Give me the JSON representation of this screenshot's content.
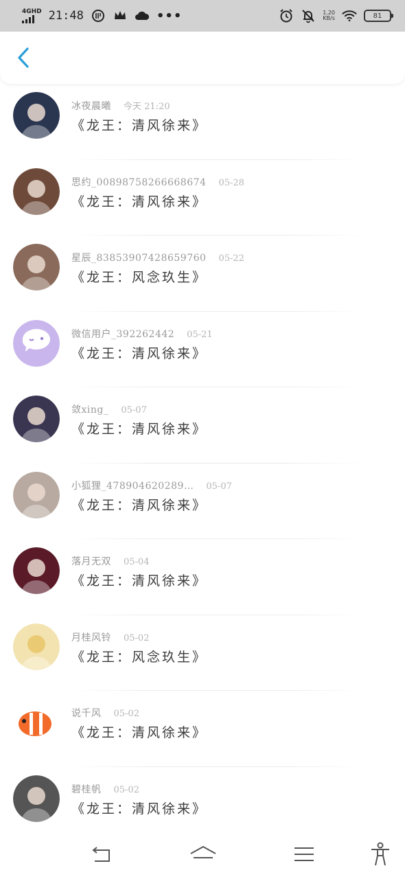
{
  "status_bar": {
    "network": "4GHD",
    "time": "21:48",
    "speed_value": "1.20",
    "speed_unit": "KB/s",
    "battery": "81"
  },
  "header": {
    "back_icon": "chevron-left-icon",
    "accent_color": "#2a9fd8"
  },
  "items": [
    {
      "user": "冰夜晨曦",
      "date": "今天 21:20",
      "title": "《龙王：清风徐来》",
      "avatar_color": "#2a3550"
    },
    {
      "user": "思约_008987582666686​74",
      "date": "05-28",
      "title": "《龙王：清风徐来》",
      "avatar_color": "#6e4a3a"
    },
    {
      "user": "星辰_83853907428659760",
      "date": "05-22",
      "title": "《龙王：风念玖生》",
      "avatar_color": "#8a6a5a"
    },
    {
      "user": "微信用户_392262442",
      "date": "05-21",
      "title": "《龙王：清风徐来》",
      "avatar_color": "#c9b6ec"
    },
    {
      "user": "敛xing_",
      "date": "05-07",
      "title": "《龙王：清风徐来》",
      "avatar_color": "#3a3550"
    },
    {
      "user": "小狐狸_478904620289…",
      "date": "05-07",
      "title": "《龙王：清风徐来》",
      "avatar_color": "#b8aaa0"
    },
    {
      "user": "落月无双",
      "date": "05-04",
      "title": "《龙王：清风徐来》",
      "avatar_color": "#5a1a28"
    },
    {
      "user": "月桂风铃",
      "date": "05-02",
      "title": "《龙王：风念玖生》",
      "avatar_color": "#f3e3b0"
    },
    {
      "user": "说千风",
      "date": "05-02",
      "title": "《龙王：清风徐来》",
      "avatar_color": "#ffffff"
    },
    {
      "user": "碧桂帆",
      "date": "05-02",
      "title": "《龙王：清风徐来》",
      "avatar_color": "#555555"
    }
  ],
  "nav": {
    "back": "back-icon",
    "home": "home-icon",
    "menu": "menu-icon",
    "accessibility": "accessibility-icon"
  }
}
